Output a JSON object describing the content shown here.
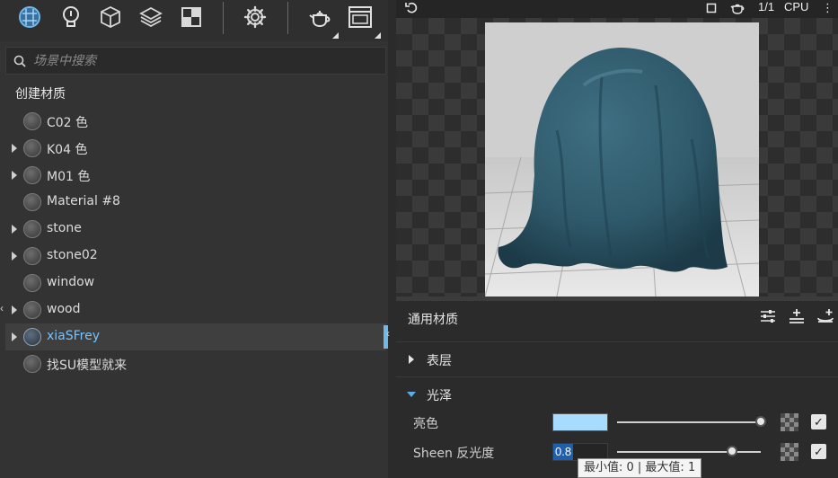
{
  "toolbar": {
    "icons": [
      "material-ball-icon",
      "light-bulb-icon",
      "cube-icon",
      "layers-icon",
      "texture-icon",
      "gear-icon",
      "teapot-icon",
      "window-icon"
    ]
  },
  "search": {
    "placeholder": "场景中搜索"
  },
  "section_title": "创建材质",
  "materials": [
    {
      "label": "C02 色",
      "expandable": false,
      "selected": false
    },
    {
      "label": "K04 色",
      "expandable": true,
      "selected": false
    },
    {
      "label": "M01 色",
      "expandable": true,
      "selected": false
    },
    {
      "label": "Material #8",
      "expandable": false,
      "selected": false
    },
    {
      "label": "stone",
      "expandable": true,
      "selected": false
    },
    {
      "label": "stone02",
      "expandable": true,
      "selected": false
    },
    {
      "label": "window",
      "expandable": false,
      "selected": false
    },
    {
      "label": "wood",
      "expandable": true,
      "selected": false
    },
    {
      "label": "xiaSFrey",
      "expandable": true,
      "selected": true
    },
    {
      "label": "找SU模型就来",
      "expandable": false,
      "selected": false
    }
  ],
  "preview": {
    "count": "1/1",
    "device": "CPU"
  },
  "properties": {
    "title": "通用材质",
    "groups": [
      {
        "title": "表层",
        "expanded": false
      },
      {
        "title": "光泽",
        "expanded": true
      }
    ],
    "rows": [
      {
        "label": "亮色",
        "kind": "color",
        "color": "#a8dcff",
        "slider_fraction": 1.0,
        "checked": true
      },
      {
        "label": "Sheen 反光度",
        "kind": "number",
        "value": "0.8",
        "slider_fraction": 0.8,
        "checked": true
      }
    ],
    "tooltip": "最小值: 0 | 最大值: 1"
  },
  "colors": {
    "selection_text": "#76c3ff",
    "accent": "#5aaee6",
    "cloth": "#2f5a6b"
  }
}
